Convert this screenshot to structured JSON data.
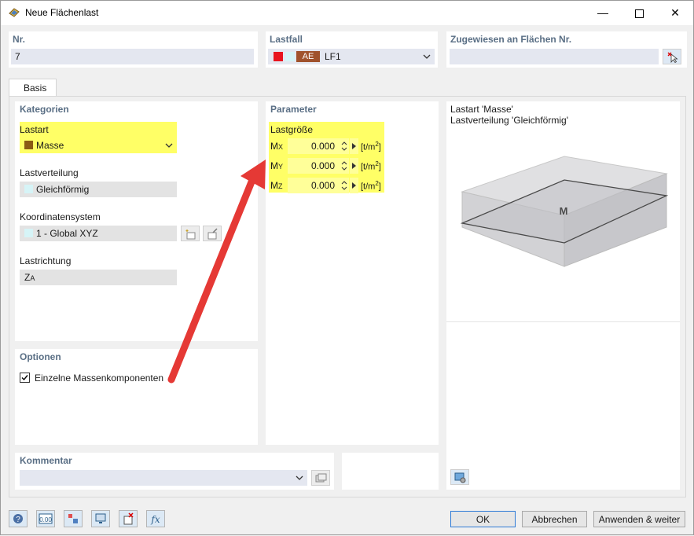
{
  "window": {
    "title": "Neue Flächenlast"
  },
  "header": {
    "nr_label": "Nr.",
    "nr_value": "7",
    "lastfall_label": "Lastfall",
    "lastfall_tag": "AE",
    "lastfall_value": "LF1",
    "assigned_label": "Zugewiesen an Flächen Nr.",
    "assigned_value": ""
  },
  "tabs": [
    {
      "label": "Basis"
    }
  ],
  "kategorien": {
    "title": "Kategorien",
    "lastart_label": "Lastart",
    "lastart_value": "Masse",
    "verteilung_label": "Lastverteilung",
    "verteilung_value": "Gleichförmig",
    "koord_label": "Koordinatensystem",
    "koord_value": "1 - Global XYZ",
    "richtung_label": "Lastrichtung",
    "richtung_value_main": "Z",
    "richtung_value_sub": "A"
  },
  "optionen": {
    "title": "Optionen",
    "checkbox_label": "Einzelne Massenkomponenten",
    "checked": true
  },
  "parameter": {
    "title": "Parameter",
    "lastgroesse_label": "Lastgröße",
    "rows": [
      {
        "main": "M",
        "sub": "X",
        "value": "0.000",
        "unit": "[t/m",
        "unit_sup": "2",
        "unit_end": "]"
      },
      {
        "main": "M",
        "sub": "Y",
        "value": "0.000",
        "unit": "[t/m",
        "unit_sup": "2",
        "unit_end": "]"
      },
      {
        "main": "M",
        "sub": "Z",
        "value": "0.000",
        "unit": "[t/m",
        "unit_sup": "2",
        "unit_end": "]"
      }
    ]
  },
  "preview": {
    "line1": "Lastart 'Masse'",
    "line2": "Lastverteilung 'Gleichförmig'",
    "box_label": "M"
  },
  "kommentar": {
    "title": "Kommentar",
    "value": ""
  },
  "footer": {
    "ok": "OK",
    "cancel": "Abbrechen",
    "apply_next": "Anwenden & weiter"
  },
  "colors": {
    "accent_yellow": "#ffff66",
    "section_title": "#5a6f85",
    "lastfall_red": "#e8141e",
    "lastfall_tag": "#a0522d",
    "masse_swatch": "#8b5a14",
    "arrow_red": "#e53935"
  },
  "icons": [
    "app-icon",
    "minimize-icon",
    "maximize-icon",
    "close-icon",
    "pick-surface-icon",
    "chevron-down-icon",
    "new-coordsys-icon",
    "edit-coordsys-icon",
    "checkbox-icon",
    "spin-up-icon",
    "spin-down-icon",
    "arrow-right-icon",
    "preview-settings-icon",
    "comment-library-icon",
    "help-icon",
    "units-icon",
    "display-icon",
    "view-icon",
    "delete-icon",
    "formula-icon"
  ]
}
